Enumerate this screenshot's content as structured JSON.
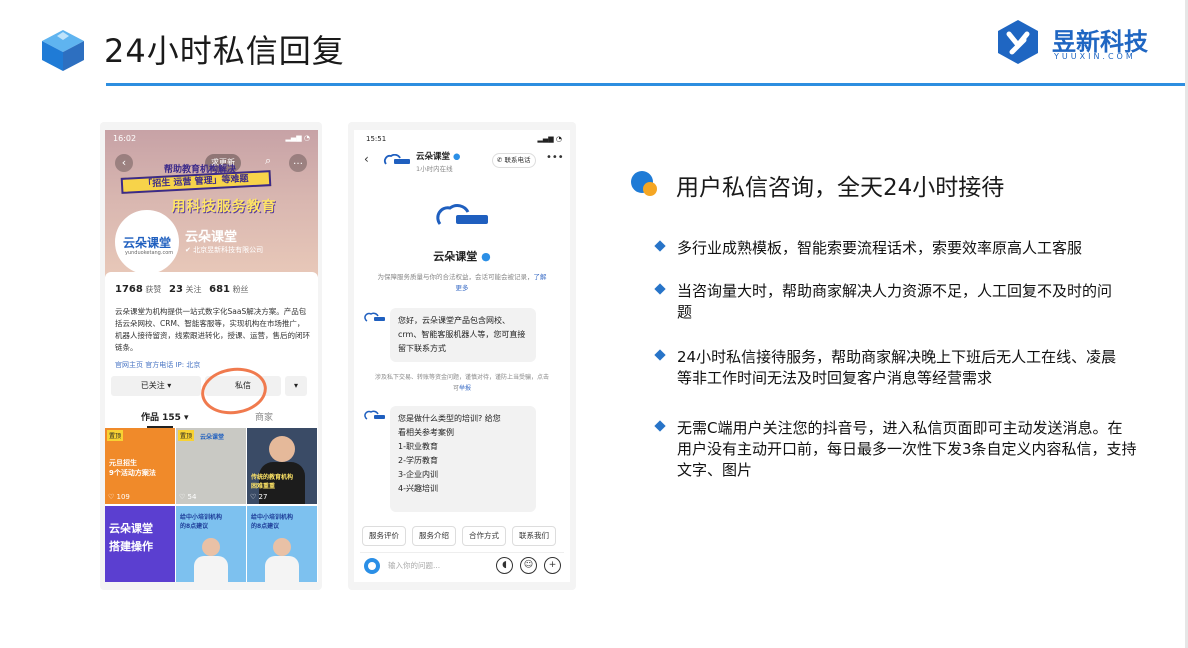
{
  "slide": {
    "title": "24小时私信回复",
    "brand": {
      "name": "昱新科技",
      "sub": "YUUXIN.COM"
    },
    "section_title": "用户私信咨询，全天24小时接待",
    "bullets": [
      "多行业成熟模板，智能索要流程话术，索要效率原高人工客服",
      "当咨询量大时，帮助商家解决人力资源不足，人工回复不及时的问题",
      "24小时私信接待服务，帮助商家解决晚上下班后无人工在线、凌晨等非工作时间无法及时回复客户消息等经营需求",
      "无需C端用户关注您的抖音号，进入私信页面即可主动发送消息。在用户没有主动开口前，每日最多一次性下发3条自定义内容私信，支持文字、图片"
    ],
    "colors": {
      "accent": "#2d8ee0",
      "brand": "#1f66c2",
      "bullet": "#2774c8"
    }
  },
  "phone1": {
    "status_time": "16:02",
    "update_label": "求更新",
    "promo_line1": "帮助教育机构解决",
    "promo_line2": "「招生 运营 管理」等难题",
    "promo_line3": "用科技服务教育",
    "avatar_text": "云朵课堂",
    "avatar_sub": "yunduoketang.com",
    "account_name": "云朵课堂",
    "company": "北京昱新科技有限公司",
    "stats": {
      "likes": "1768",
      "likes_label": "获赞",
      "following": "23",
      "following_label": "关注",
      "fans": "681",
      "fans_label": "粉丝"
    },
    "description": "云朵课堂为机构提供一站式数字化SaaS解决方案。产品包括云朵网校、CRM、智能客服等，实现机构在市场推广，机器人接待留资，线索跟进转化，授课、运营，售后的闭环链条。",
    "links": "官网主页  官方电话  IP: 北京",
    "follow_label": "已关注 ▾",
    "message_label": "私信",
    "dropdown_label": "▾",
    "tab_works": "作品 155 ▾",
    "tab_shop": "商家",
    "tiles": [
      {
        "badge": "置顶",
        "text": "元旦招生\n9个活动方案法",
        "likes": "♡ 109"
      },
      {
        "badge": "置顶",
        "text": "云朵课堂",
        "likes": "♡ 54"
      },
      {
        "badge": "",
        "text": "传统的教育机构\n困难重重",
        "likes": "♡ 27"
      },
      {
        "badge": "",
        "text": "云朵课堂\n搭建操作",
        "likes": ""
      },
      {
        "badge": "",
        "text": "给中小培训机构\n的8点建议",
        "likes": ""
      },
      {
        "badge": "",
        "text": "给中小培训机构\n的8点建议",
        "likes": ""
      }
    ]
  },
  "phone2": {
    "status_time": "15:51",
    "contact_name": "云朵课堂",
    "online_status": "1小时内在线",
    "phone_label": "联系电话",
    "brand_name": "云朵课堂",
    "notice": "为保障服务质量与你的合法权益，会话可能会被记录，",
    "notice_link": "了解更多",
    "msg1": "您好，云朵课堂产品包含网校、crm、智能客服机器人等，您可直接留下联系方式",
    "warning": "涉及私下交易、转账等资金问题，谨慎对待，谨防上当受骗，点击可",
    "warning_link": "举报",
    "msg2_lines": [
      "您是做什么类型的培训? 给您",
      "看相关参考案例",
      "1-职业教育",
      "2-学历教育",
      "3-企业内训",
      "4-兴趣培训"
    ],
    "quick_replies": [
      "服务评价",
      "服务介绍",
      "合作方式",
      "联系我们"
    ],
    "input_placeholder": "输入你的问题..."
  }
}
